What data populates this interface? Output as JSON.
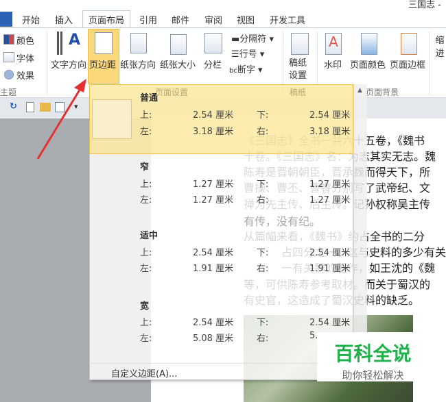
{
  "window": {
    "title": "三国志 -"
  },
  "tabs": [
    "开始",
    "插入",
    "页面布局",
    "引用",
    "邮件",
    "审阅",
    "视图",
    "开发工具"
  ],
  "ribbon": {
    "theme": {
      "colors": "颜色",
      "fonts": "字体",
      "effects": "效果",
      "group": "主题"
    },
    "page_setup": {
      "text_direction": "文字方向",
      "margins": "页边距",
      "orientation": "纸张方向",
      "size": "纸张大小",
      "columns": "分栏",
      "breaks": "分隔符",
      "line_numbers": "行号",
      "hyphenation": "断字",
      "group": "页面设置"
    },
    "draft": {
      "setup": "稿纸\n设置",
      "group": "稿纸"
    },
    "background": {
      "watermark": "水印",
      "page_color": "页面颜色",
      "page_borders": "页面边框",
      "group": "页面背景"
    },
    "indent": "缩进"
  },
  "margins_menu": {
    "presets": [
      {
        "name": "普通",
        "top": "2.54 厘米",
        "bottom": "2.54 厘米",
        "left": "3.18 厘米",
        "right": "3.18 厘米"
      },
      {
        "name": "窄",
        "top": "1.27 厘米",
        "bottom": "1.27 厘米",
        "left": "1.27 厘米",
        "right": "1.27 厘米"
      },
      {
        "name": "适中",
        "top": "2.54 厘米",
        "bottom": "2.54 厘米",
        "left": "1.91 厘米",
        "right": "1.91 厘米"
      },
      {
        "name": "宽",
        "top": "2.54 厘米",
        "bottom": "2.54 厘米",
        "left": "5.08 厘米",
        "right": "5."
      }
    ],
    "labels": {
      "top": "上:",
      "bottom": "下:",
      "left": "左:",
      "right": "右:"
    },
    "custom": "自定义边距(A)..."
  },
  "document": {
    "lines": [
      "《三国志》全书一共六十五卷，《魏书",
      "十卷。《三国志》名：为志其实无志。魏",
      "陈寿是晋朝朝臣，晋承魏而得天下，所",
      "曹操、曹丕、曹睿分别写了武帝纪、文",
      "禅为先主传、后主传。记孙权称吴主传",
      "有传，没有纪。",
      "从篇幅来看，《魏书》约占全书的二分",
      "占四分之一，这与史料的多少有关",
      "一有关魏的著作，如王沈的《魏",
      "等，可供陈寿参考取材。而关于蜀汉的",
      "有史官，这造成了蜀汉史料的缺乏。"
    ]
  },
  "watermark": {
    "title": "百科全说",
    "subtitle": "助你轻松解决"
  }
}
